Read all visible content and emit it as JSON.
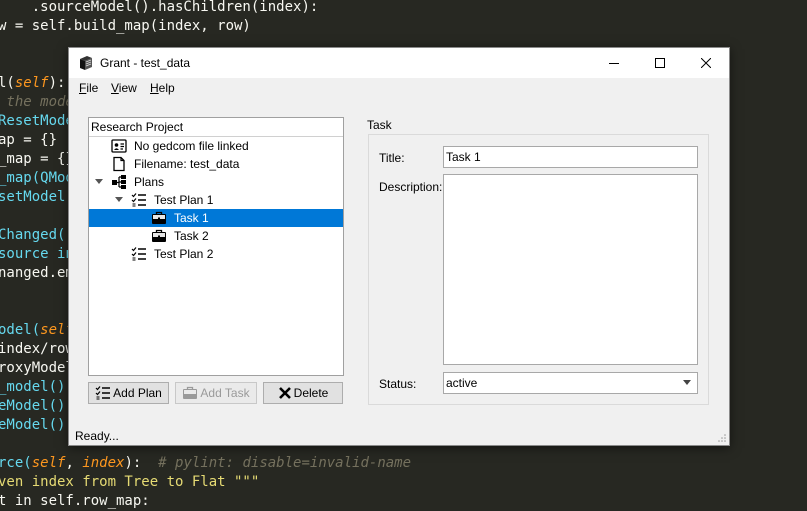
{
  "background_code": {
    "lines": [
      [
        {
          "t": "    ",
          "c": ""
        },
        {
          "t": ".sourceModel().hasChildren(index):",
          "c": ""
        }
      ],
      [
        {
          "t": "w = self.build_map(index, row)",
          "c": ""
        }
      ],
      [],
      [],
      [
        {
          "t": "l(",
          "c": ""
        },
        {
          "t": "self",
          "c": "it"
        },
        {
          "t": "):",
          "c": ""
        }
      ],
      [
        {
          "t": " the model",
          "c": "cm"
        }
      ],
      [
        {
          "t": "ResetModel",
          "c": "kw"
        }
      ],
      [
        {
          "t": "ap = {}",
          "c": ""
        }
      ],
      [
        {
          "t": "_map = {}",
          "c": ""
        }
      ],
      [
        {
          "t": "_map(QMod",
          "c": "kw"
        }
      ],
      [
        {
          "t": "setModel(",
          "c": "kw"
        }
      ],
      [],
      [
        {
          "t": "Changed(.",
          "c": "kw"
        }
      ],
      [
        {
          "t": "source in",
          "c": "kw"
        }
      ],
      [
        {
          "t": "nanged.em",
          "c": ""
        }
      ],
      [],
      [],
      [
        {
          "t": "odel(",
          "c": "kw"
        },
        {
          "t": "self",
          "c": "it"
        }
      ],
      [
        {
          "t": "index/row",
          "c": ""
        }
      ],
      [
        {
          "t": "roxyModel",
          "c": ""
        }
      ],
      [
        {
          "t": "_model()",
          "c": "kw"
        }
      ],
      [
        {
          "t": "eModel().",
          "c": "kw"
        }
      ],
      [
        {
          "t": "eModel().",
          "c": "kw"
        }
      ],
      [],
      [
        {
          "t": "rce(",
          "c": "kw"
        },
        {
          "t": "self",
          "c": "it"
        },
        {
          "t": ", ",
          "c": ""
        },
        {
          "t": "index",
          "c": "it"
        },
        {
          "t": "):  ",
          "c": ""
        },
        {
          "t": "# pylint: disable=invalid-name",
          "c": "cm"
        }
      ],
      [
        {
          "t": "ven index from Tree to Flat \"\"\"",
          "c": "st"
        }
      ],
      [
        {
          "t": "t in self.row_map:",
          "c": ""
        }
      ]
    ]
  },
  "window": {
    "title": "Grant - test_data",
    "controls": {
      "minimize": "minimize",
      "maximize": "maximize",
      "close": "close"
    }
  },
  "menu": {
    "file": {
      "accel": "F",
      "rest": "ile"
    },
    "view": {
      "accel": "V",
      "rest": "iew"
    },
    "help": {
      "accel": "H",
      "rest": "elp"
    }
  },
  "tree": {
    "header": "Research Project",
    "items": [
      {
        "label": "No gedcom file linked",
        "icon": "id-card-icon",
        "depth": 1
      },
      {
        "label": "Filename: test_data",
        "icon": "file-icon",
        "depth": 1
      },
      {
        "label": "Plans",
        "icon": "sitemap-icon",
        "depth": 0,
        "expanded": true
      },
      {
        "label": "Test Plan 1",
        "icon": "checklist-icon",
        "depth": 1,
        "expanded": true
      },
      {
        "label": "Task 1",
        "icon": "briefcase-icon",
        "depth": 2,
        "selected": true
      },
      {
        "label": "Task 2",
        "icon": "briefcase-icon",
        "depth": 2
      },
      {
        "label": "Test Plan 2",
        "icon": "checklist-icon",
        "depth": 1
      }
    ]
  },
  "buttons": {
    "add_plan": "Add Plan",
    "add_task": "Add Task",
    "delete": "Delete"
  },
  "task": {
    "group_title": "Task",
    "title_label": "Title:",
    "title_value": "Task 1",
    "description_label": "Description:",
    "description_value": "",
    "status_label": "Status:",
    "status_value": "active"
  },
  "status_bar": "Ready...",
  "colors": {
    "selection": "#0078d7",
    "editor_bg": "#272822"
  }
}
